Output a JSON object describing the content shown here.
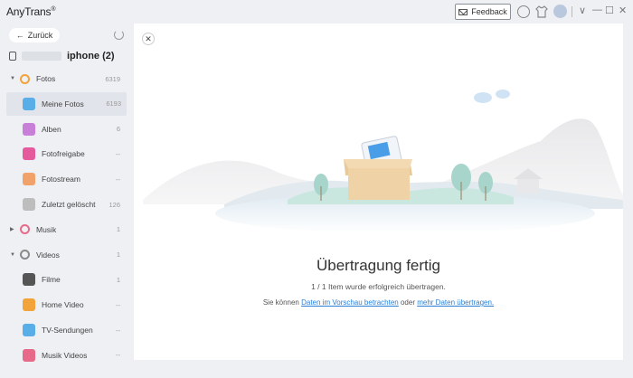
{
  "app": {
    "title": "AnyTrans",
    "trademark": "®"
  },
  "titlebar": {
    "feedback_label": "Feedback",
    "minimize": "—",
    "maximize": "☐",
    "close": "✕",
    "dropdown": "∨"
  },
  "sidebar": {
    "back_label": "Zurück",
    "device_name": "iphone (2)",
    "items": [
      {
        "label": "Fotos",
        "count": "6319",
        "level": 0,
        "arrow": "▼",
        "icon": "photos-icon",
        "color": "#f2a33a"
      },
      {
        "label": "Meine Fotos",
        "count": "6193",
        "level": 1,
        "icon": "my-photos-icon",
        "color": "#5aaee8",
        "active": true
      },
      {
        "label": "Alben",
        "count": "6",
        "level": 1,
        "icon": "albums-icon",
        "color": "#c77fd8"
      },
      {
        "label": "Fotofreigabe",
        "count": "--",
        "level": 1,
        "icon": "photo-sharing-icon",
        "color": "#e45a9c"
      },
      {
        "label": "Fotostream",
        "count": "--",
        "level": 1,
        "icon": "photostream-icon",
        "color": "#f0a26a"
      },
      {
        "label": "Zuletzt gelöscht",
        "count": "126",
        "level": 1,
        "icon": "trash-icon",
        "color": "#bdbdbd"
      },
      {
        "label": "Musik",
        "count": "1",
        "level": 0,
        "arrow": "▶",
        "icon": "music-icon",
        "color": "#e86a8a"
      },
      {
        "label": "Videos",
        "count": "1",
        "level": 0,
        "arrow": "▼",
        "icon": "videos-icon",
        "color": "#8a8a8a"
      },
      {
        "label": "Filme",
        "count": "1",
        "level": 1,
        "icon": "movies-icon",
        "color": "#555555"
      },
      {
        "label": "Home Video",
        "count": "--",
        "level": 1,
        "icon": "home-video-icon",
        "color": "#f2a33a"
      },
      {
        "label": "TV-Sendungen",
        "count": "--",
        "level": 1,
        "icon": "tv-shows-icon",
        "color": "#5aaee8"
      },
      {
        "label": "Musik Videos",
        "count": "--",
        "level": 1,
        "icon": "music-videos-icon",
        "color": "#e86a8a"
      }
    ]
  },
  "main": {
    "close_label": "✕",
    "title": "Übertragung fertig",
    "subtitle": "1 / 1 Item wurde erfolgreich übertragen.",
    "hint_prefix": "Sie können",
    "hint_link1": "Daten im Vorschau betrachten",
    "hint_middle": "oder",
    "hint_link2": "mehr Daten übertragen."
  }
}
